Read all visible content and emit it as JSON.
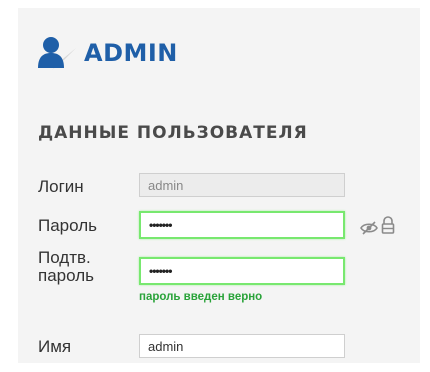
{
  "header": {
    "title": "ADMIN",
    "icon": "user-icon",
    "color": "#1f5fa8"
  },
  "section": {
    "title": "ДАННЫЕ ПОЛЬЗОВАТЕЛЯ"
  },
  "form": {
    "login": {
      "label": "Логин",
      "value": "admin"
    },
    "password": {
      "label": "Пароль",
      "value": "•••••••",
      "icons": [
        "eye-slash-icon",
        "lock-icon"
      ]
    },
    "confirm": {
      "label_line1": "Подтв.",
      "label_line2": "пароль",
      "value": "•••••••",
      "hint": "пароль введен верно"
    },
    "name": {
      "label": "Имя",
      "value": "admin"
    }
  },
  "colors": {
    "valid_border": "#78e86f",
    "hint": "#2aa33a",
    "panel_bg": "#f4f4f4"
  }
}
